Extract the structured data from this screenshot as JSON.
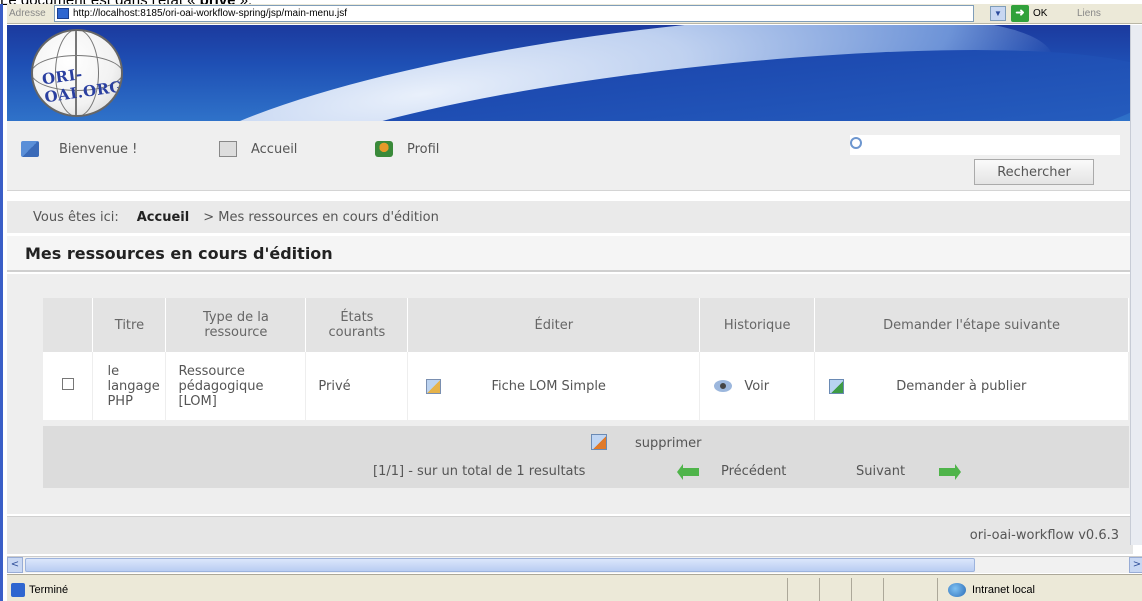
{
  "caption": {
    "before": "Le document est dans l'état « ",
    "bold": "privé",
    "after": " »."
  },
  "browser": {
    "address_label": "Adresse",
    "url": "http://localhost:8185/ori-oai-workflow-spring/jsp/main-menu.jsf",
    "go_label": "OK",
    "links_label": "Liens"
  },
  "banner": {
    "logo_text": "ORI-OAI.ORG"
  },
  "nav": {
    "welcome": "Bienvenue !",
    "home": "Accueil",
    "profile": "Profil",
    "search_value": "",
    "search_button": "Rechercher"
  },
  "breadcrumb": {
    "prefix": "Vous êtes ici:",
    "home": "Accueil",
    "current": "> Mes ressources en cours d'édition"
  },
  "page": {
    "title": "Mes ressources en cours d'édition"
  },
  "table": {
    "headers": {
      "title": "Titre",
      "type": "Type de la ressource",
      "states": "États courants",
      "edit": "Éditer",
      "history": "Historique",
      "next_step": "Demander l'étape suivante"
    },
    "rows": [
      {
        "checked": false,
        "title": "le langage PHP",
        "type": "Ressource pédagogique [LOM]",
        "state": "Privé",
        "edit_link": "Fiche LOM Simple",
        "history_link": "Voir",
        "next_step_link": "Demander à publier"
      }
    ],
    "footer": {
      "delete": "supprimer",
      "pagination": "[1/1] - sur un total de 1 resultats",
      "previous": "Précédent",
      "next": "Suivant"
    }
  },
  "version": "ori-oai-workflow v0.6.3",
  "status": {
    "text": "Terminé",
    "zone": "Intranet local"
  }
}
